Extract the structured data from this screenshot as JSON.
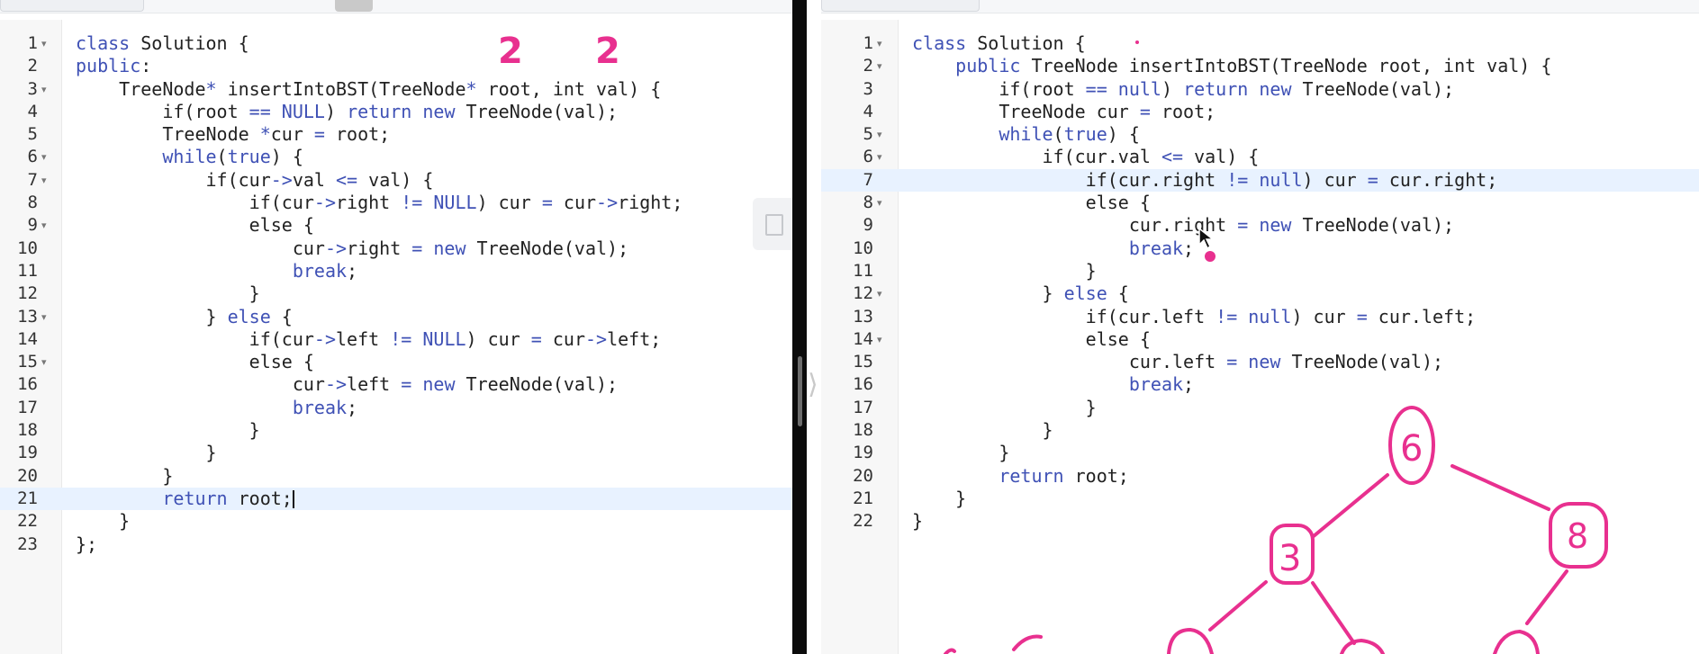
{
  "colors": {
    "keyword": "#3f51b5",
    "operator": "#3f51b5",
    "annotation": "#e8308f",
    "highlight": "#e8f2ff"
  },
  "left_editor": {
    "lines": [
      {
        "n": "1",
        "fold": true,
        "t": [
          [
            "class",
            "kw"
          ],
          [
            " Solution {",
            ""
          ]
        ]
      },
      {
        "n": "2",
        "fold": false,
        "t": [
          [
            "public",
            "kw"
          ],
          [
            ":",
            ""
          ]
        ]
      },
      {
        "n": "3",
        "fold": true,
        "t": [
          [
            "    TreeNode",
            ""
          ],
          [
            "*",
            "op"
          ],
          [
            " insertIntoBST(TreeNode",
            ""
          ],
          [
            "*",
            "op"
          ],
          [
            " root, int val) {",
            ""
          ]
        ]
      },
      {
        "n": "4",
        "fold": false,
        "t": [
          [
            "        if(root ",
            ""
          ],
          [
            "==",
            "op"
          ],
          [
            " ",
            ""
          ],
          [
            "NULL",
            "kw"
          ],
          [
            ") ",
            ""
          ],
          [
            "return",
            "kw"
          ],
          [
            " ",
            ""
          ],
          [
            "new",
            "kw"
          ],
          [
            " TreeNode(val);",
            ""
          ]
        ]
      },
      {
        "n": "5",
        "fold": false,
        "t": [
          [
            "        TreeNode ",
            ""
          ],
          [
            "*",
            "op"
          ],
          [
            "cur ",
            ""
          ],
          [
            "=",
            "op"
          ],
          [
            " root;",
            ""
          ]
        ]
      },
      {
        "n": "6",
        "fold": true,
        "t": [
          [
            "        ",
            ""
          ],
          [
            "while",
            "kw"
          ],
          [
            "(",
            ""
          ],
          [
            "true",
            "kw"
          ],
          [
            ") {",
            ""
          ]
        ]
      },
      {
        "n": "7",
        "fold": true,
        "t": [
          [
            "            if(cur",
            ""
          ],
          [
            "->",
            "op"
          ],
          [
            "val ",
            ""
          ],
          [
            "<=",
            "op"
          ],
          [
            " val) {",
            ""
          ]
        ]
      },
      {
        "n": "8",
        "fold": false,
        "t": [
          [
            "                if(cur",
            ""
          ],
          [
            "->",
            "op"
          ],
          [
            "right ",
            ""
          ],
          [
            "!=",
            "op"
          ],
          [
            " ",
            ""
          ],
          [
            "NULL",
            "kw"
          ],
          [
            ") cur ",
            ""
          ],
          [
            "=",
            "op"
          ],
          [
            " cur",
            ""
          ],
          [
            "->",
            "op"
          ],
          [
            "right;",
            ""
          ]
        ]
      },
      {
        "n": "9",
        "fold": true,
        "t": [
          [
            "                else {",
            ""
          ]
        ]
      },
      {
        "n": "10",
        "fold": false,
        "t": [
          [
            "                    cur",
            ""
          ],
          [
            "->",
            "op"
          ],
          [
            "right ",
            ""
          ],
          [
            "=",
            "op"
          ],
          [
            " ",
            ""
          ],
          [
            "new",
            "kw"
          ],
          [
            " TreeNode(val);",
            ""
          ]
        ]
      },
      {
        "n": "11",
        "fold": false,
        "t": [
          [
            "                    ",
            ""
          ],
          [
            "break",
            "kw"
          ],
          [
            ";",
            ""
          ]
        ]
      },
      {
        "n": "12",
        "fold": false,
        "t": [
          [
            "                }",
            ""
          ]
        ]
      },
      {
        "n": "13",
        "fold": true,
        "t": [
          [
            "            } ",
            ""
          ],
          [
            "else",
            "kw"
          ],
          [
            " {",
            ""
          ]
        ]
      },
      {
        "n": "14",
        "fold": false,
        "t": [
          [
            "                if(cur",
            ""
          ],
          [
            "->",
            "op"
          ],
          [
            "left ",
            ""
          ],
          [
            "!=",
            "op"
          ],
          [
            " ",
            ""
          ],
          [
            "NULL",
            "kw"
          ],
          [
            ") cur ",
            ""
          ],
          [
            "=",
            "op"
          ],
          [
            " cur",
            ""
          ],
          [
            "->",
            "op"
          ],
          [
            "left;",
            ""
          ]
        ]
      },
      {
        "n": "15",
        "fold": true,
        "t": [
          [
            "                else {",
            ""
          ]
        ]
      },
      {
        "n": "16",
        "fold": false,
        "t": [
          [
            "                    cur",
            ""
          ],
          [
            "->",
            "op"
          ],
          [
            "left ",
            ""
          ],
          [
            "=",
            "op"
          ],
          [
            " ",
            ""
          ],
          [
            "new",
            "kw"
          ],
          [
            " TreeNode(val);",
            ""
          ]
        ]
      },
      {
        "n": "17",
        "fold": false,
        "t": [
          [
            "                    ",
            ""
          ],
          [
            "break",
            "kw"
          ],
          [
            ";",
            ""
          ]
        ]
      },
      {
        "n": "18",
        "fold": false,
        "t": [
          [
            "                }",
            ""
          ]
        ]
      },
      {
        "n": "19",
        "fold": false,
        "t": [
          [
            "            }",
            ""
          ]
        ]
      },
      {
        "n": "20",
        "fold": false,
        "t": [
          [
            "        }",
            ""
          ]
        ]
      },
      {
        "n": "21",
        "fold": false,
        "hl": true,
        "caret": true,
        "t": [
          [
            "        ",
            ""
          ],
          [
            "return",
            "kw"
          ],
          [
            " root;",
            ""
          ]
        ]
      },
      {
        "n": "22",
        "fold": false,
        "t": [
          [
            "    }",
            ""
          ]
        ]
      },
      {
        "n": "23",
        "fold": false,
        "t": [
          [
            "};",
            ""
          ]
        ]
      }
    ]
  },
  "right_editor": {
    "lines": [
      {
        "n": "1",
        "fold": true,
        "t": [
          [
            "class",
            "kw"
          ],
          [
            " Solution {",
            ""
          ]
        ]
      },
      {
        "n": "2",
        "fold": true,
        "t": [
          [
            "    ",
            ""
          ],
          [
            "public",
            "kw"
          ],
          [
            " TreeNode insertIntoBST(TreeNode root, int val) {",
            ""
          ]
        ]
      },
      {
        "n": "3",
        "fold": false,
        "t": [
          [
            "        if(root ",
            ""
          ],
          [
            "==",
            "op"
          ],
          [
            " ",
            ""
          ],
          [
            "null",
            "kw"
          ],
          [
            ") ",
            ""
          ],
          [
            "return",
            "kw"
          ],
          [
            " ",
            ""
          ],
          [
            "new",
            "kw"
          ],
          [
            " TreeNode(val);",
            ""
          ]
        ]
      },
      {
        "n": "4",
        "fold": false,
        "t": [
          [
            "        TreeNode cur ",
            ""
          ],
          [
            "=",
            "op"
          ],
          [
            " root;",
            ""
          ]
        ]
      },
      {
        "n": "5",
        "fold": true,
        "t": [
          [
            "        ",
            ""
          ],
          [
            "while",
            "kw"
          ],
          [
            "(",
            ""
          ],
          [
            "true",
            "kw"
          ],
          [
            ") {",
            ""
          ]
        ]
      },
      {
        "n": "6",
        "fold": true,
        "t": [
          [
            "            if(cur.val ",
            ""
          ],
          [
            "<=",
            "op"
          ],
          [
            " val) {",
            ""
          ]
        ]
      },
      {
        "n": "7",
        "fold": false,
        "hl": true,
        "t": [
          [
            "                if(cur.right ",
            ""
          ],
          [
            "!=",
            "op"
          ],
          [
            " ",
            ""
          ],
          [
            "null",
            "kw"
          ],
          [
            ") cur ",
            ""
          ],
          [
            "=",
            "op"
          ],
          [
            " cur.right;",
            ""
          ]
        ]
      },
      {
        "n": "8",
        "fold": true,
        "t": [
          [
            "                else {",
            ""
          ]
        ]
      },
      {
        "n": "9",
        "fold": false,
        "t": [
          [
            "                    cur.right ",
            ""
          ],
          [
            "=",
            "op"
          ],
          [
            " ",
            ""
          ],
          [
            "new",
            "kw"
          ],
          [
            " TreeNode(val);",
            ""
          ]
        ]
      },
      {
        "n": "10",
        "fold": false,
        "t": [
          [
            "                    ",
            ""
          ],
          [
            "break",
            "kw"
          ],
          [
            ";",
            ""
          ]
        ]
      },
      {
        "n": "11",
        "fold": false,
        "t": [
          [
            "                }",
            ""
          ]
        ]
      },
      {
        "n": "12",
        "fold": true,
        "t": [
          [
            "            } ",
            ""
          ],
          [
            "else",
            "kw"
          ],
          [
            " {",
            ""
          ]
        ]
      },
      {
        "n": "13",
        "fold": false,
        "t": [
          [
            "                if(cur.left ",
            ""
          ],
          [
            "!=",
            "op"
          ],
          [
            " ",
            ""
          ],
          [
            "null",
            "kw"
          ],
          [
            ") cur ",
            ""
          ],
          [
            "=",
            "op"
          ],
          [
            " cur.left;",
            ""
          ]
        ]
      },
      {
        "n": "14",
        "fold": true,
        "t": [
          [
            "                else {",
            ""
          ]
        ]
      },
      {
        "n": "15",
        "fold": false,
        "t": [
          [
            "                    cur.left ",
            ""
          ],
          [
            "=",
            "op"
          ],
          [
            " ",
            ""
          ],
          [
            "new",
            "kw"
          ],
          [
            " TreeNode(val);",
            ""
          ]
        ]
      },
      {
        "n": "16",
        "fold": false,
        "t": [
          [
            "                    ",
            ""
          ],
          [
            "break",
            "kw"
          ],
          [
            ";",
            ""
          ]
        ]
      },
      {
        "n": "17",
        "fold": false,
        "t": [
          [
            "                }",
            ""
          ]
        ]
      },
      {
        "n": "18",
        "fold": false,
        "t": [
          [
            "            }",
            ""
          ]
        ]
      },
      {
        "n": "19",
        "fold": false,
        "t": [
          [
            "        }",
            ""
          ]
        ]
      },
      {
        "n": "20",
        "fold": false,
        "t": [
          [
            "        ",
            ""
          ],
          [
            "return",
            "kw"
          ],
          [
            " root;",
            ""
          ]
        ]
      },
      {
        "n": "21",
        "fold": false,
        "t": [
          [
            "    }",
            ""
          ]
        ]
      },
      {
        "n": "22",
        "fold": false,
        "t": [
          [
            "}",
            ""
          ]
        ]
      }
    ]
  },
  "annotations": {
    "scribble_marks": [
      "2",
      "2"
    ],
    "tree_nodes": [
      "6",
      "3",
      "8"
    ]
  }
}
